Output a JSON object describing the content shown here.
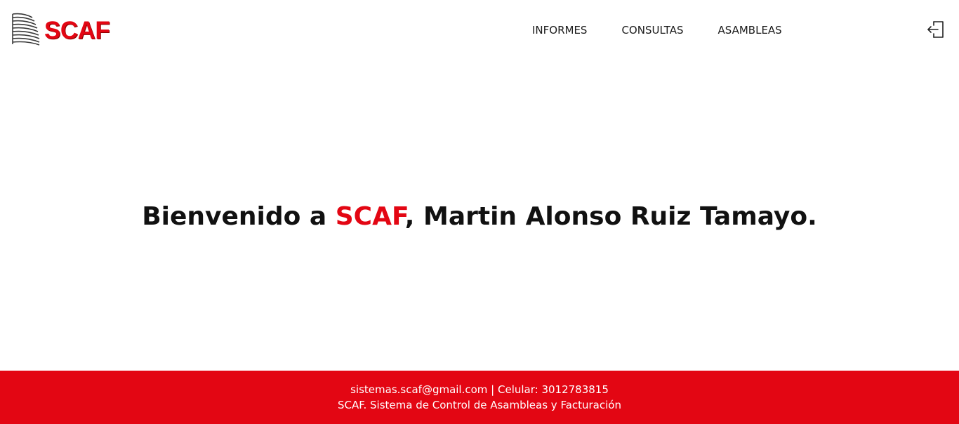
{
  "brand": {
    "name": "SCAF",
    "color": "#e30613"
  },
  "nav": {
    "items": [
      {
        "label": "INFORMES"
      },
      {
        "label": "CONSULTAS"
      },
      {
        "label": "ASAMBLEAS"
      }
    ],
    "logout_icon": "logout-icon"
  },
  "main": {
    "welcome_prefix": "Bienvenido a ",
    "welcome_brand": "SCAF",
    "welcome_suffix": ", Martin Alonso Ruiz Tamayo."
  },
  "footer": {
    "contact_line": "sistemas.scaf@gmail.com | Celular: 3012783815",
    "tagline": "SCAF. Sistema de Control de Asambleas y Facturación",
    "background": "#e30613"
  }
}
